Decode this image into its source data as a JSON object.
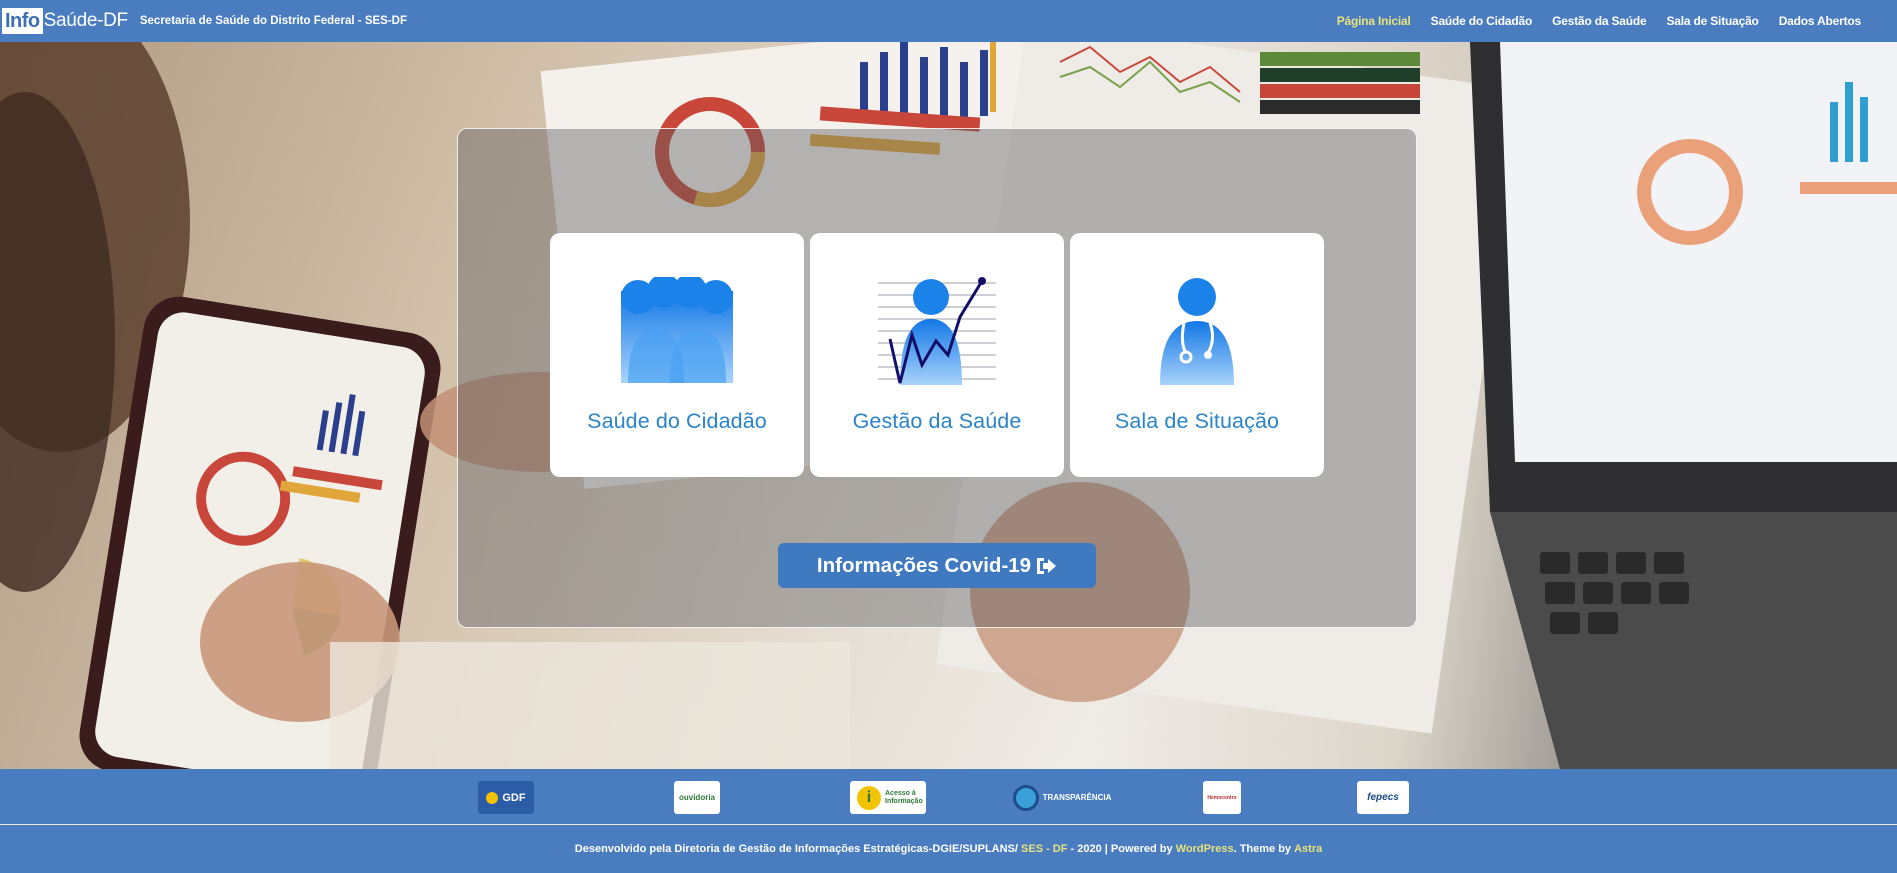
{
  "header": {
    "brand_info": "Info",
    "brand_rest": "Saúde-DF",
    "tagline": "Secretaria de Saúde do Distrito Federal - SES-DF",
    "nav": [
      {
        "label": "Página Inicial",
        "active": true
      },
      {
        "label": "Saúde do Cidadão",
        "active": false
      },
      {
        "label": "Gestão da Saúde",
        "active": false
      },
      {
        "label": "Sala de Situação",
        "active": false
      },
      {
        "label": "Dados Abertos",
        "active": false
      }
    ]
  },
  "cards": [
    {
      "label": "Saúde do Cidadão",
      "icon": "people-group-icon"
    },
    {
      "label": "Gestão da Saúde",
      "icon": "person-chart-icon"
    },
    {
      "label": "Sala de Situação",
      "icon": "doctor-stethoscope-icon"
    }
  ],
  "covid_button": {
    "label": "Informações Covid-19",
    "icon": "sign-out-icon"
  },
  "logos": [
    {
      "name": "gdf-logo",
      "text": "GDF"
    },
    {
      "name": "ouvidoria-logo",
      "text": "ouvidoria"
    },
    {
      "name": "acesso-informacao-logo",
      "text": "Acesso à Informação"
    },
    {
      "name": "transparencia-logo",
      "text": "TRANSPARÊNCIA"
    },
    {
      "name": "hemocentro-logo",
      "text": "Hemocentro"
    },
    {
      "name": "fepecs-logo",
      "text": "fepecs"
    }
  ],
  "footer": {
    "prefix": "Desenvolvido pela Diretoria de Gestão de Informações Estratégicas-DGIE/SUPLANS/ ",
    "ses_link": "SES - DF",
    "middle": " - 2020 | Powered by ",
    "wordpress_link": "WordPress",
    "theme_text": ". Theme by ",
    "astra_link": "Astra"
  },
  "colors": {
    "header_bg": "#4a7cc0",
    "active_nav": "#e8e27a",
    "card_text": "#2a84c9",
    "button_bg": "#3f79c0"
  }
}
